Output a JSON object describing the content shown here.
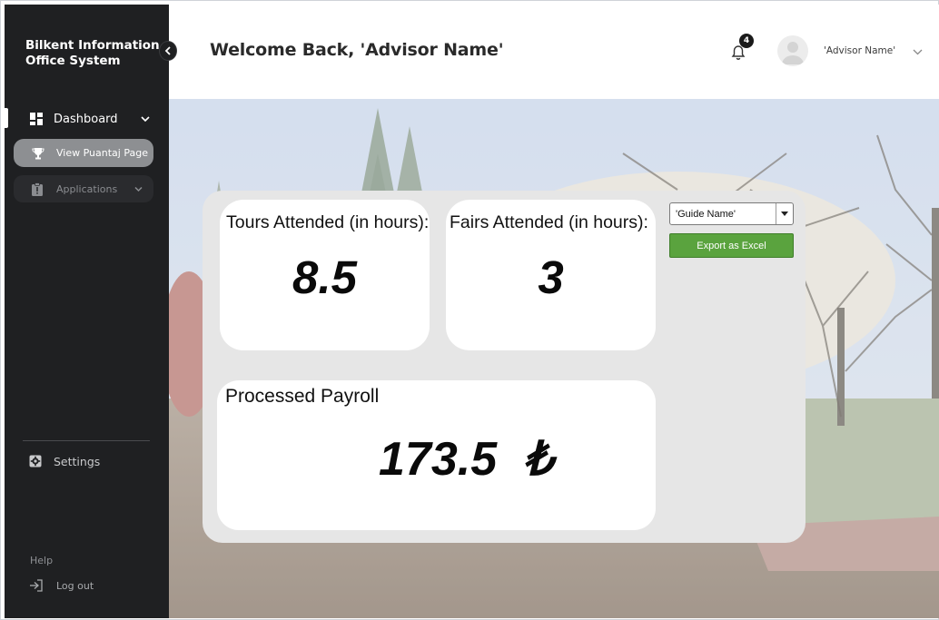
{
  "app": {
    "title": "Bilkent Information Office System"
  },
  "sidebar": {
    "items": [
      {
        "label": "Dashboard"
      },
      {
        "label": "View Puantaj Page"
      },
      {
        "label": "Applications"
      }
    ],
    "settings_label": "Settings",
    "help_label": "Help",
    "logout_label": "Log out"
  },
  "header": {
    "welcome": "Welcome Back, 'Advisor Name'",
    "notification_count": "4",
    "user_name": "'Advisor Name'"
  },
  "stats": {
    "tours": {
      "label": "Tours Attended (in hours):",
      "value": "8.5"
    },
    "fairs": {
      "label": "Fairs Attended (in hours):",
      "value": "3"
    },
    "payroll": {
      "label": "Processed Payroll",
      "value": "173.5  ₺"
    }
  },
  "controls": {
    "guide_select_value": "'Guide Name'",
    "export_label": "Export as Excel"
  },
  "colors": {
    "sidebar_bg": "#1f2022",
    "active_item_bg": "#8d8f92",
    "export_green": "#5aa33e",
    "panel_bg": "#e6e6e6"
  },
  "icons": [
    "chevron-left-icon",
    "dashboard-grid-icon",
    "chevron-down-icon",
    "trophy-icon",
    "clipboard-alert-icon",
    "gear-icon",
    "logout-icon",
    "bell-icon",
    "user-avatar-icon",
    "dropdown-arrow-icon"
  ]
}
